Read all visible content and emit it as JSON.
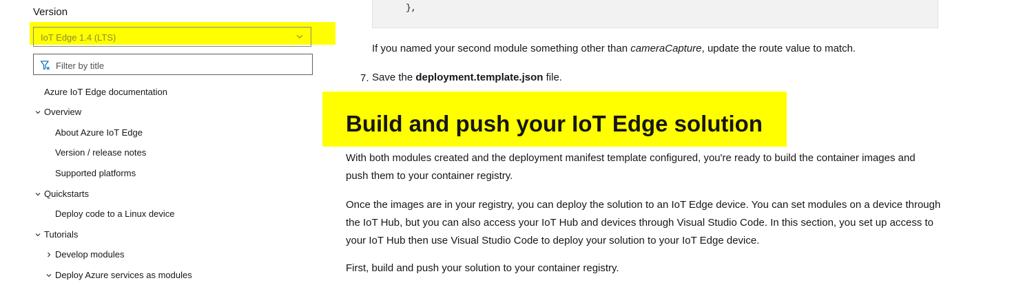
{
  "sidebar": {
    "version_label": "Version",
    "version_value": "IoT Edge 1.4 (LTS)",
    "filter_placeholder": "Filter by title",
    "toc": [
      {
        "label": "Azure IoT Edge documentation"
      },
      {
        "label": "Overview",
        "state": "expanded"
      },
      {
        "label": "About Azure IoT Edge"
      },
      {
        "label": "Version / release notes"
      },
      {
        "label": "Supported platforms"
      },
      {
        "label": "Quickstarts",
        "state": "expanded"
      },
      {
        "label": "Deploy code to a Linux device"
      },
      {
        "label": "Tutorials",
        "state": "expanded"
      },
      {
        "label": "Develop modules",
        "state": "collapsed"
      },
      {
        "label": "Deploy Azure services as modules",
        "state": "expanded"
      }
    ]
  },
  "highlight_color": "#ffff00",
  "main": {
    "code_line": "},",
    "rename_note": {
      "before": "If you named your second module something other than ",
      "em": "cameraCapture",
      "after": ", update the route value to match."
    },
    "step7": {
      "number": "7.",
      "before": "Save the ",
      "bold": "deployment.template.json",
      "after": " file."
    },
    "heading": "Build and push your IoT Edge solution",
    "para1": "With both modules created and the deployment manifest template configured, you're ready to build the container images and push them to your container registry.",
    "para2": "Once the images are in your registry, you can deploy the solution to an IoT Edge device. You can set modules on a device through the IoT Hub, but you can also access your IoT Hub and devices through Visual Studio Code. In this section, you set up access to your IoT Hub then use Visual Studio Code to deploy your solution to your IoT Edge device.",
    "para3": "First, build and push your solution to your container registry."
  }
}
